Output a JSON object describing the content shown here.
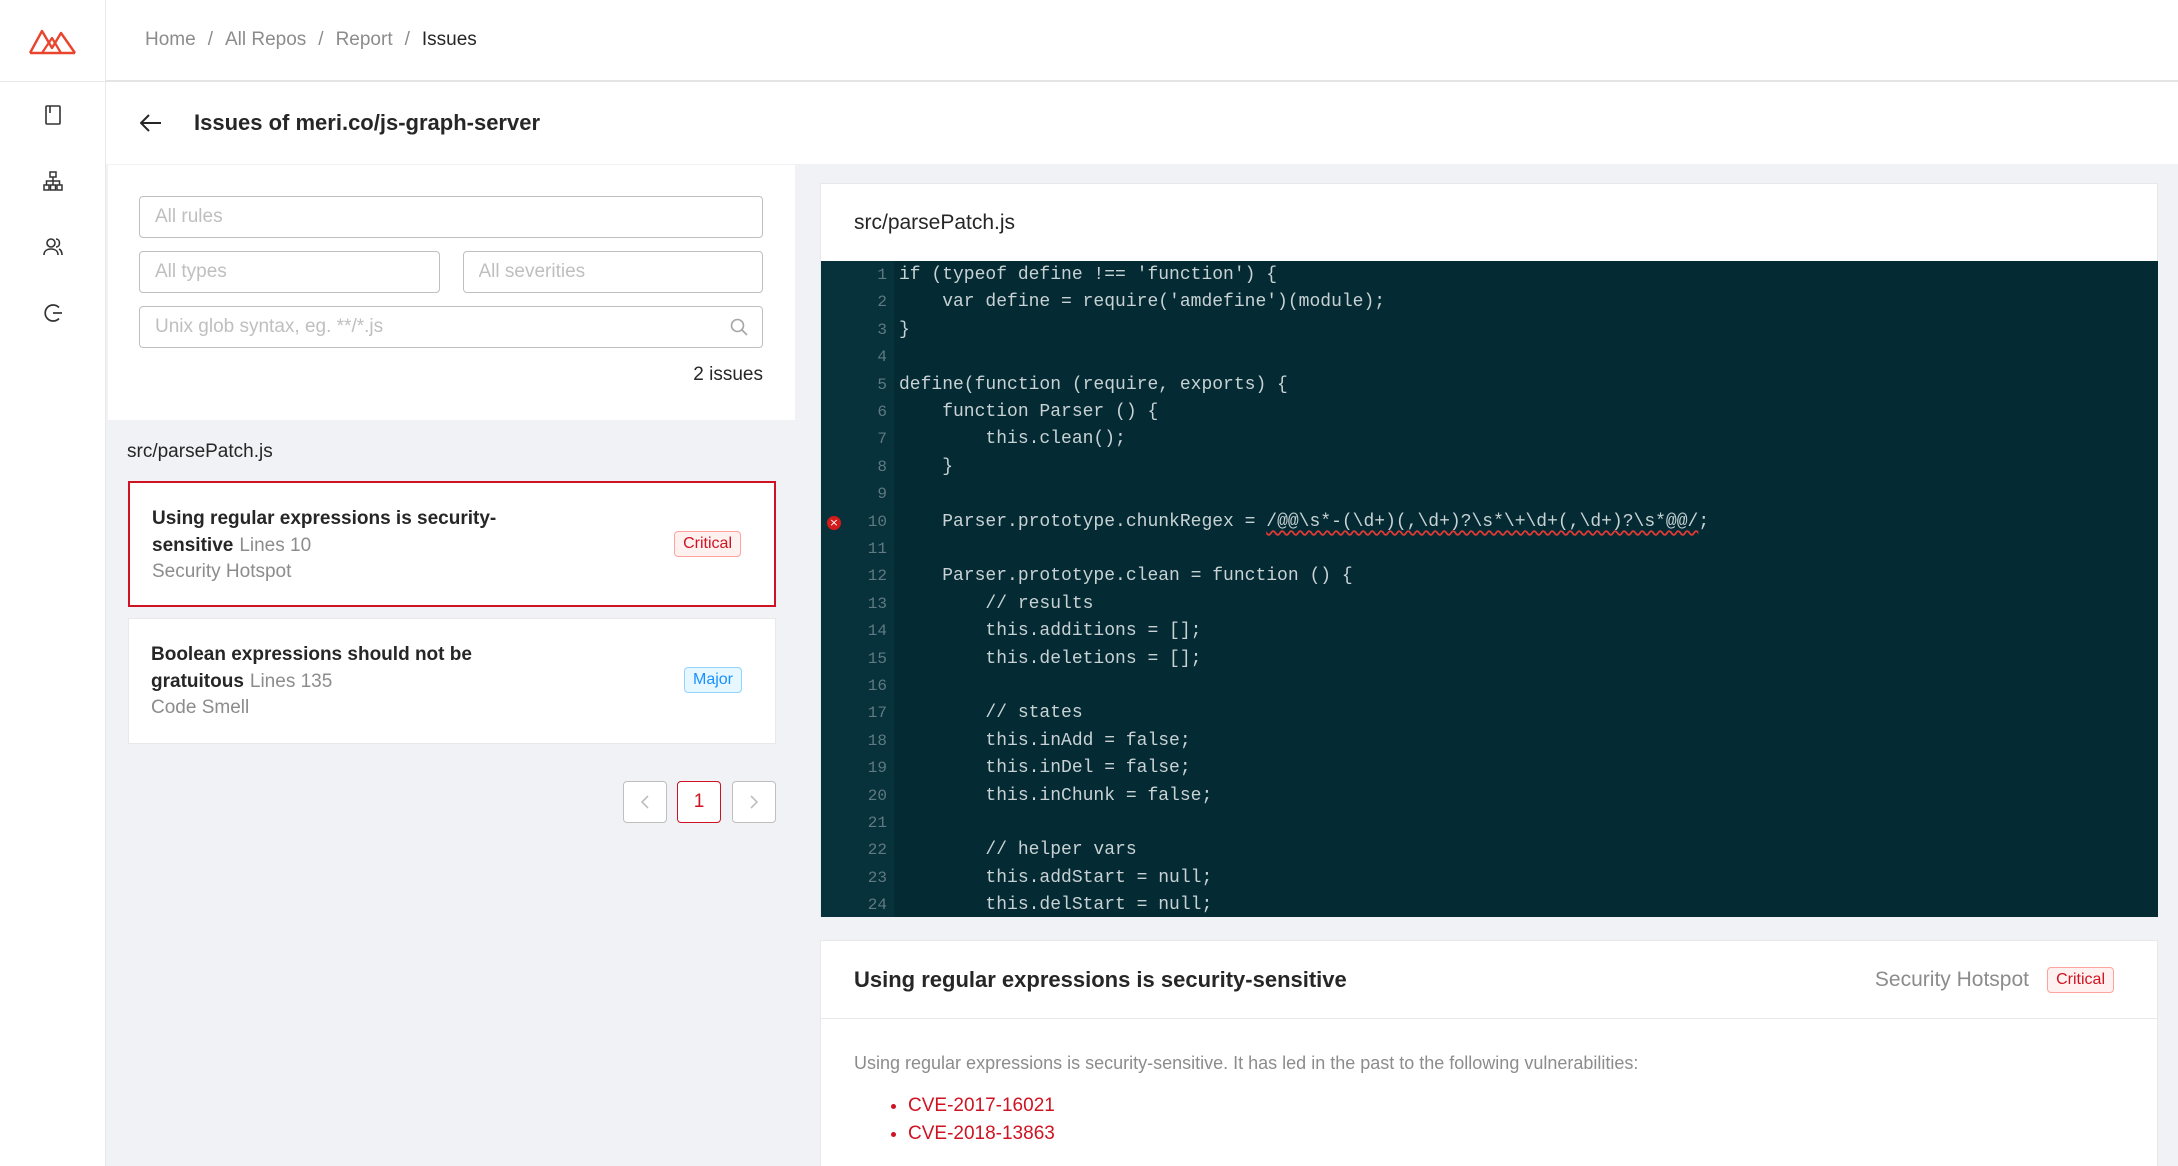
{
  "breadcrumb": {
    "items": [
      "Home",
      "All Repos",
      "Report",
      "Issues"
    ],
    "separator": "/"
  },
  "page": {
    "title": "Issues of meri.co/js-graph-server"
  },
  "filters": {
    "rules_placeholder": "All rules",
    "types_placeholder": "All types",
    "severities_placeholder": "All severities",
    "glob_placeholder": "Unix glob syntax, eg. **/*.js",
    "issue_count": "2 issues"
  },
  "issue_list": {
    "file": "src/parsePatch.js",
    "issues": [
      {
        "title": "Using regular expressions is security-sensitive",
        "lines": "Lines 10",
        "type": "Security Hotspot",
        "severity": "Critical"
      },
      {
        "title": "Boolean expressions should not be gratuitous",
        "lines": "Lines 135",
        "type": "Code Smell",
        "severity": "Major"
      }
    ]
  },
  "pagination": {
    "prev": "<",
    "current": "1",
    "next": ">"
  },
  "code_viewer": {
    "file": "src/parsePatch.js",
    "highlight_line": 10,
    "lines": [
      {
        "n": "1",
        "text": "if (typeof define !== 'function') {"
      },
      {
        "n": "2",
        "text": "    var define = require('amdefine')(module);"
      },
      {
        "n": "3",
        "text": "}"
      },
      {
        "n": "4",
        "text": ""
      },
      {
        "n": "5",
        "text": "define(function (require, exports) {"
      },
      {
        "n": "6",
        "text": "    function Parser () {"
      },
      {
        "n": "7",
        "text": "        this.clean();"
      },
      {
        "n": "8",
        "text": "    }"
      },
      {
        "n": "9",
        "text": ""
      },
      {
        "n": "10",
        "text": "    Parser.prototype.chunkRegex = ",
        "flagged": "/@@\\s*-(\\d+)(,\\d+)?\\s*\\+\\d+(,\\d+)?\\s*@@/",
        "after": ";"
      },
      {
        "n": "11",
        "text": ""
      },
      {
        "n": "12",
        "text": "    Parser.prototype.clean = function () {"
      },
      {
        "n": "13",
        "text": "        // results"
      },
      {
        "n": "14",
        "text": "        this.additions = [];"
      },
      {
        "n": "15",
        "text": "        this.deletions = [];"
      },
      {
        "n": "16",
        "text": ""
      },
      {
        "n": "17",
        "text": "        // states"
      },
      {
        "n": "18",
        "text": "        this.inAdd = false;"
      },
      {
        "n": "19",
        "text": "        this.inDel = false;"
      },
      {
        "n": "20",
        "text": "        this.inChunk = false;"
      },
      {
        "n": "21",
        "text": ""
      },
      {
        "n": "22",
        "text": "        // helper vars"
      },
      {
        "n": "23",
        "text": "        this.addStart = null;"
      },
      {
        "n": "24",
        "text": "        this.delStart = null;"
      }
    ]
  },
  "detail": {
    "title": "Using regular expressions is security-sensitive",
    "type": "Security Hotspot",
    "severity": "Critical",
    "description": "Using regular expressions is security-sensitive. It has led in the past to the following vulnerabilities:",
    "cves": [
      "CVE-2017-16021",
      "CVE-2018-13863"
    ]
  },
  "colors": {
    "accent": "#cf1322",
    "code_bg": "#042a33"
  },
  "icons": {
    "logo": "mountain-logo",
    "nav": [
      "book-icon",
      "hierarchy-icon",
      "users-icon",
      "logout-icon"
    ]
  }
}
